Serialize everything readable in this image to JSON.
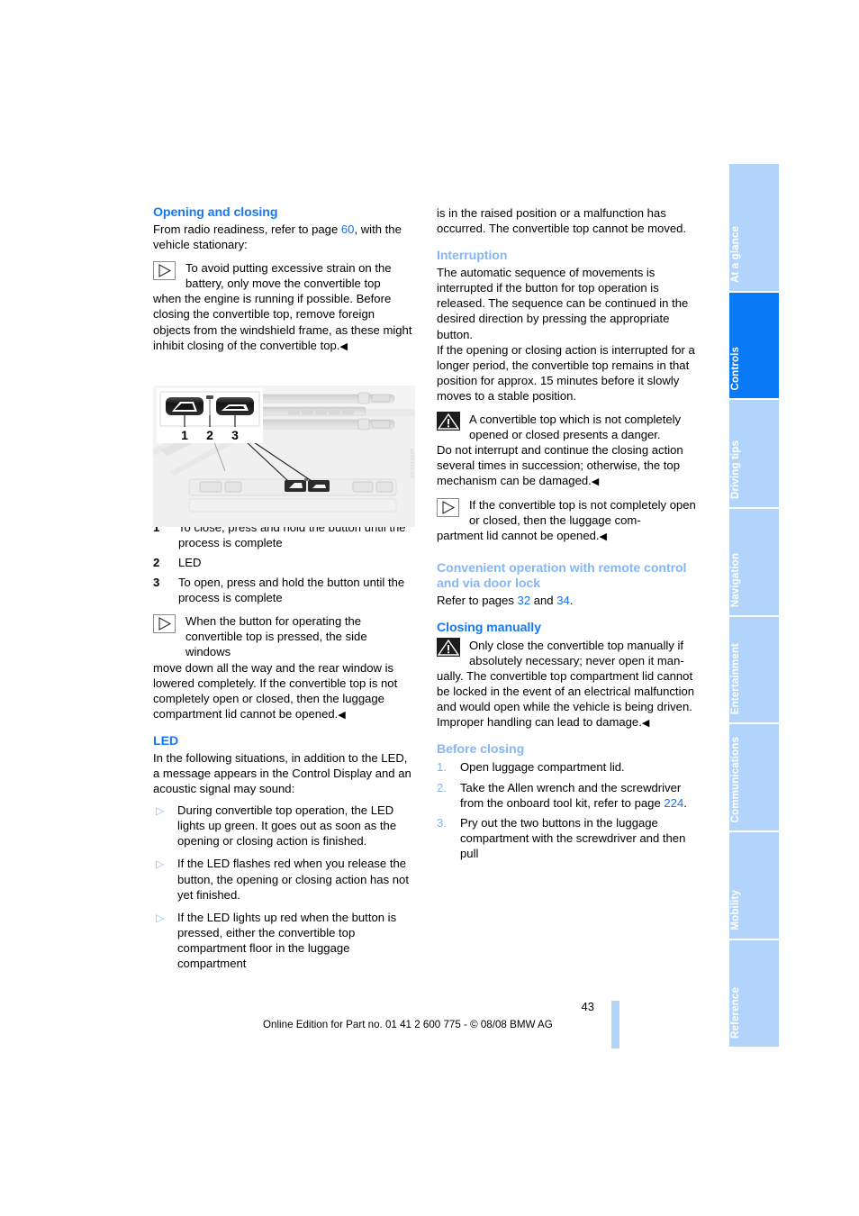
{
  "document": {
    "page_number": "43",
    "footer_text": "Online Edition for Part no. 01 41 2 600 775 - © 08/08 BMW AG",
    "figure_code": "ab9211b-00"
  },
  "colors": {
    "heading_strong": "#1778f2",
    "heading_light": "#86b7f5",
    "page_ref_link": "#1b6ff0",
    "tab_inactive": "#b3d4fa",
    "tab_active": "#0a79f5",
    "bullet": "#8cbcf7"
  },
  "left_column": {
    "heading": "Opening and closing",
    "intro_pre": "From radio readiness, refer to page ",
    "intro_ref": "60",
    "intro_post": ", with the vehicle stationary:",
    "note_1": {
      "icon": "note-triangle-icon",
      "indented_text": "To avoid putting excessive strain on the battery, only move the convertible top",
      "full_text": "when the engine is running if possible. Before closing the convertible top, remove foreign objects from the windshield frame, as these might inhibit closing of the convertible top.",
      "endmark": "◀"
    },
    "legend": [
      {
        "num": "1",
        "text": "To close, press and hold the button until the process is complete"
      },
      {
        "num": "2",
        "text": "LED"
      },
      {
        "num": "3",
        "text": "To open, press and hold the button until the process is complete"
      }
    ],
    "note_2": {
      "icon": "note-triangle-icon",
      "indented_text": "When the button for operating the convertible top is pressed, the side windows",
      "full_text": "move down all the way and the rear window is lowered completely. If the convertible top is not completely open or closed, then the luggage compartment lid cannot be opened.",
      "endmark": "◀"
    },
    "led_heading": "LED",
    "led_intro": "In the following situations, in addition to the LED, a message appears in the Control Display and an acoustic signal may sound:",
    "led_bullets": [
      "During convertible top operation, the LED lights up green. It goes out as soon as the opening or closing action is finished.",
      "If the LED flashes red when you release the button, the opening or closing action has not yet finished.",
      "If the LED lights up red when the button is pressed, either the convertible top compartment floor in the luggage compartment"
    ]
  },
  "right_column": {
    "continuation": "is in the raised position or a malfunction has occurred. The convertible top cannot be moved.",
    "interruption_heading": "Interruption",
    "interruption_p1": "The automatic sequence of movements is interrupted if the button for top operation is released. The sequence can be continued in the desired direction by pressing the appropriate button.",
    "interruption_p2": "If the opening or closing action is interrupted for a longer period, the convertible top remains in that position for approx. 15 minutes before it slowly moves to a stable position.",
    "warning_1": {
      "icon": "warning-triangle-icon",
      "indented_text": "A convertible top which is not completely opened or closed presents a danger.",
      "full_text": "Do not interrupt and continue the closing action several times in succession; otherwise, the top mechanism can be damaged.",
      "endmark": "◀"
    },
    "note_3": {
      "icon": "note-triangle-icon",
      "indented_text": "If the convertible top is not completely open or closed, then the luggage com-",
      "full_text": "partment lid cannot be opened.",
      "endmark": "◀"
    },
    "convenient_heading": "Convenient operation with remote control and via door lock",
    "convenient_pre": "Refer to pages ",
    "convenient_ref1": "32",
    "convenient_mid": " and ",
    "convenient_ref2": "34",
    "convenient_post": ".",
    "closing_manually_heading": "Closing manually",
    "warning_2": {
      "icon": "warning-triangle-icon",
      "indented_text": "Only close the convertible top manually if absolutely necessary; never open it man-",
      "full_text": "ually. The convertible top compartment lid cannot be locked in the event of an electrical malfunction and would open while the vehicle is being driven.",
      "closing_line": "Improper handling can lead to damage.",
      "endmark": "◀"
    },
    "before_closing_heading": "Before closing",
    "steps": [
      {
        "num": "1.",
        "text": "Open luggage compartment lid."
      },
      {
        "num": "2.",
        "text_pre": "Take the Allen wrench and the screwdriver from the onboard tool kit, refer to page ",
        "ref": "224",
        "text_post": "."
      },
      {
        "num": "3.",
        "text": "Pry out the two buttons in the luggage compartment with the screwdriver and then pull"
      }
    ]
  },
  "sidebar": {
    "tabs": [
      {
        "label": "At a glance",
        "active": false
      },
      {
        "label": "Controls",
        "active": true
      },
      {
        "label": "Driving tips",
        "active": false
      },
      {
        "label": "Navigation",
        "active": false
      },
      {
        "label": "Entertainment",
        "active": false
      },
      {
        "label": "Communications",
        "active": false
      },
      {
        "label": "Mobility",
        "active": false
      },
      {
        "label": "Reference",
        "active": false
      }
    ]
  }
}
